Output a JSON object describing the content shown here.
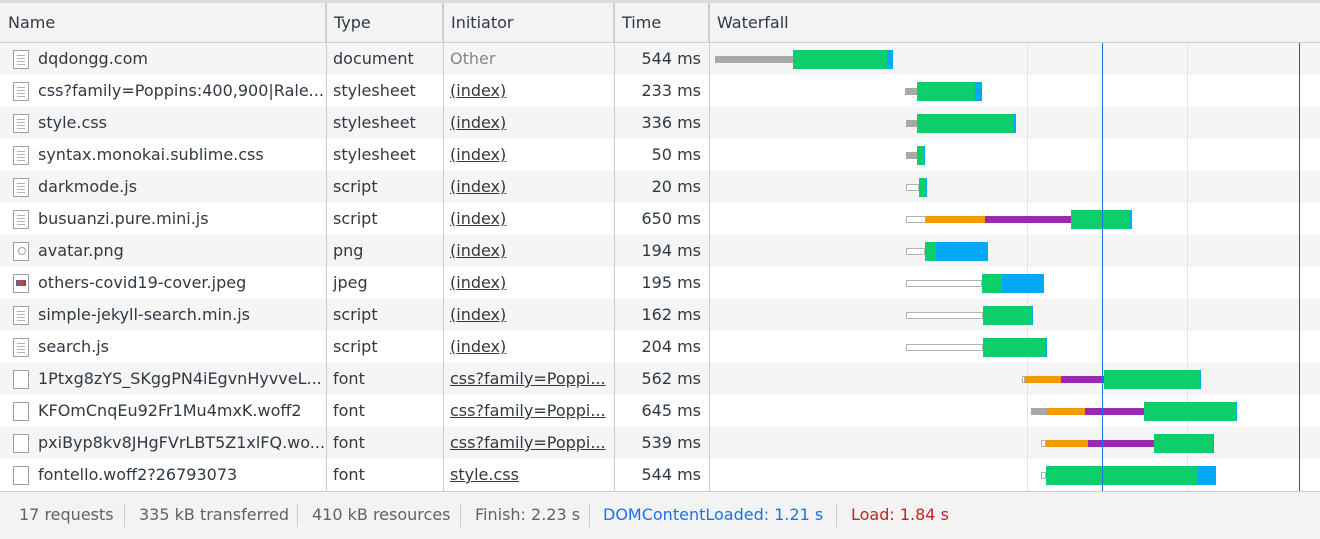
{
  "columns": {
    "name": "Name",
    "type": "Type",
    "initiator": "Initiator",
    "time": "Time",
    "waterfall": "Waterfall"
  },
  "rows": [
    {
      "name": "dqdongg.com",
      "type": "document",
      "initiator": "Other",
      "time": "544 ms",
      "icon": "document-icon"
    },
    {
      "name": "css?family=Poppins:400,900|Rale...",
      "type": "stylesheet",
      "initiator": "(index)",
      "time": "233 ms",
      "icon": "document-icon"
    },
    {
      "name": "style.css",
      "type": "stylesheet",
      "initiator": "(index)",
      "time": "336 ms",
      "icon": "document-icon"
    },
    {
      "name": "syntax.monokai.sublime.css",
      "type": "stylesheet",
      "initiator": "(index)",
      "time": "50 ms",
      "icon": "document-icon"
    },
    {
      "name": "darkmode.js",
      "type": "script",
      "initiator": "(index)",
      "time": "20 ms",
      "icon": "document-icon"
    },
    {
      "name": "busuanzi.pure.mini.js",
      "type": "script",
      "initiator": "(index)",
      "time": "650 ms",
      "icon": "document-icon"
    },
    {
      "name": "avatar.png",
      "type": "png",
      "initiator": "(index)",
      "time": "194 ms",
      "icon": "image-thumbnail-icon"
    },
    {
      "name": "others-covid19-cover.jpeg",
      "type": "jpeg",
      "initiator": "(index)",
      "time": "195 ms",
      "icon": "image-thumbnail-icon"
    },
    {
      "name": "simple-jekyll-search.min.js",
      "type": "script",
      "initiator": "(index)",
      "time": "162 ms",
      "icon": "document-icon"
    },
    {
      "name": "search.js",
      "type": "script",
      "initiator": "(index)",
      "time": "204 ms",
      "icon": "document-icon"
    },
    {
      "name": "1Ptxg8zYS_SKggPN4iEgvnHyvveL...",
      "type": "font",
      "initiator": "css?family=Poppi...",
      "time": "562 ms",
      "icon": "font-file-icon"
    },
    {
      "name": "KFOmCnqEu92Fr1Mu4mxK.woff2",
      "type": "font",
      "initiator": "css?family=Poppi...",
      "time": "645 ms",
      "icon": "font-file-icon"
    },
    {
      "name": "pxiByp8kv8JHgFVrLBT5Z1xlFQ.wo...",
      "type": "font",
      "initiator": "css?family=Poppi...",
      "time": "539 ms",
      "icon": "font-file-icon"
    },
    {
      "name": "fontello.woff2?26793073",
      "type": "font",
      "initiator": "style.css",
      "time": "544 ms",
      "icon": "font-file-icon"
    }
  ],
  "footer": {
    "requests": "17 requests",
    "transferred": "335 kB transferred",
    "resources": "410 kB resources",
    "finish": "Finish: 2.23 s",
    "domcontentloaded": "DOMContentLoaded: 1.21 s",
    "load": "Load: 1.84 s"
  },
  "colors": {
    "queueing": "#ffffff",
    "stalled": "#a8a8a8",
    "dns": "#f29900",
    "ssl": "#9c27b0",
    "waiting": "#0cce6b",
    "download": "#03a9f4",
    "domcontentloaded_line": "#1a73e8",
    "load_line": "#c5221f"
  }
}
